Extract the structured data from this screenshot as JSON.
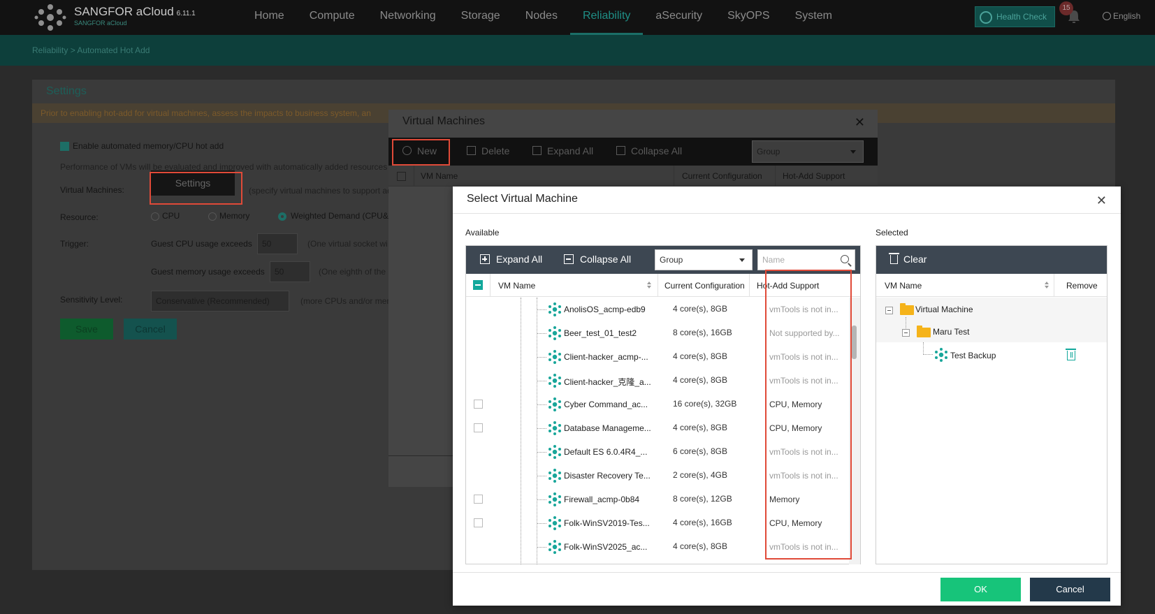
{
  "app": {
    "brand": "SANGFOR aCloud",
    "version": "6.11.1",
    "brand_sub": "SANGFOR aCloud",
    "nav": [
      "Home",
      "Compute",
      "Networking",
      "Storage",
      "Nodes",
      "Reliability",
      "aSecurity",
      "SkyOPS",
      "System"
    ],
    "active_nav": "Reliability",
    "health_check": "Health Check",
    "notifications": "15",
    "language": "English"
  },
  "breadcrumb": {
    "parent": "Reliability",
    "sep": ">",
    "current": "Automated Hot Add"
  },
  "settings_page": {
    "title": "Settings",
    "warning": "Prior to enabling hot-add for virtual machines, assess the impacts to business system, an",
    "enable_label": "Enable automated memory/CPU hot add",
    "perf_note": "Performance of VMs will be evaluated and improved with automatically added resources",
    "vm_label": "Virtual Machines:",
    "settings_btn": "Settings",
    "vm_hint": "(specify virtual machines to support ad",
    "resource_label": "Resource:",
    "resource_options": [
      "CPU",
      "Memory",
      "Weighted Demand (CPU&"
    ],
    "trigger_label": "Trigger:",
    "cpu_trigger": "Guest CPU usage exceeds",
    "cpu_value": "50",
    "cpu_hint": "(One virtual socket wi",
    "mem_trigger": "Guest memory usage exceeds",
    "mem_value": "50",
    "mem_hint": "(One eighth of the",
    "sensitivity_label": "Sensitivity Level:",
    "sensitivity_value": "Conservative (Recommended)",
    "sensitivity_hint": "(more CPUs and/or mem",
    "save": "Save",
    "cancel": "Cancel"
  },
  "vm_modal": {
    "title": "Virtual Machines",
    "toolbar": {
      "new": "New",
      "delete": "Delete",
      "expand_all": "Expand All",
      "collapse_all": "Collapse All",
      "group": "Group"
    },
    "columns": [
      "VM Name",
      "Current Configuration",
      "Hot-Add Support"
    ]
  },
  "select_modal": {
    "title": "Select Virtual Machine",
    "available_label": "Available",
    "selected_label": "Selected",
    "toolbar": {
      "expand_all": "Expand All",
      "collapse_all": "Collapse All",
      "group": "Group",
      "name_placeholder": "Name"
    },
    "columns": {
      "vm_name": "VM Name",
      "config": "Current Configuration",
      "hot_add": "Hot-Add Support"
    },
    "rows": [
      {
        "name": "AnolisOS_acmp-edb9",
        "config": "4 core(s), 8GB",
        "hot_add": "vmTools is not in...",
        "checkbox": false
      },
      {
        "name": "Beer_test_01_test2",
        "config": "8 core(s), 16GB",
        "hot_add": "Not supported by...",
        "checkbox": false
      },
      {
        "name": "Client-hacker_acmp-...",
        "config": "4 core(s), 8GB",
        "hot_add": "vmTools is not in...",
        "checkbox": false
      },
      {
        "name": "Client-hacker_克隆_a...",
        "config": "4 core(s), 8GB",
        "hot_add": "vmTools is not in...",
        "checkbox": false
      },
      {
        "name": "Cyber Command_ac...",
        "config": "16 core(s), 32GB",
        "hot_add": "CPU, Memory",
        "checkbox": true
      },
      {
        "name": "Database Manageme...",
        "config": "4 core(s), 8GB",
        "hot_add": "CPU, Memory",
        "checkbox": true
      },
      {
        "name": "Default ES 6.0.4R4_...",
        "config": "6 core(s), 8GB",
        "hot_add": "vmTools is not in...",
        "checkbox": false
      },
      {
        "name": "Disaster Recovery Te...",
        "config": "2 core(s), 4GB",
        "hot_add": "vmTools is not in...",
        "checkbox": false
      },
      {
        "name": "Firewall_acmp-0b84",
        "config": "8 core(s), 12GB",
        "hot_add": "Memory",
        "checkbox": true
      },
      {
        "name": "Folk-WinSV2019-Tes...",
        "config": "4 core(s), 16GB",
        "hot_add": "CPU, Memory",
        "checkbox": true
      },
      {
        "name": "Folk-WinSV2025_ac...",
        "config": "4 core(s), 8GB",
        "hot_add": "vmTools is not in...",
        "checkbox": false
      }
    ],
    "selected": {
      "clear": "Clear",
      "columns": {
        "vm_name": "VM Name",
        "remove": "Remove"
      },
      "tree": {
        "root": "Virtual Machine",
        "group": "Maru Test",
        "vm": "Test Backup"
      }
    },
    "ok": "OK",
    "cancel": "Cancel"
  }
}
